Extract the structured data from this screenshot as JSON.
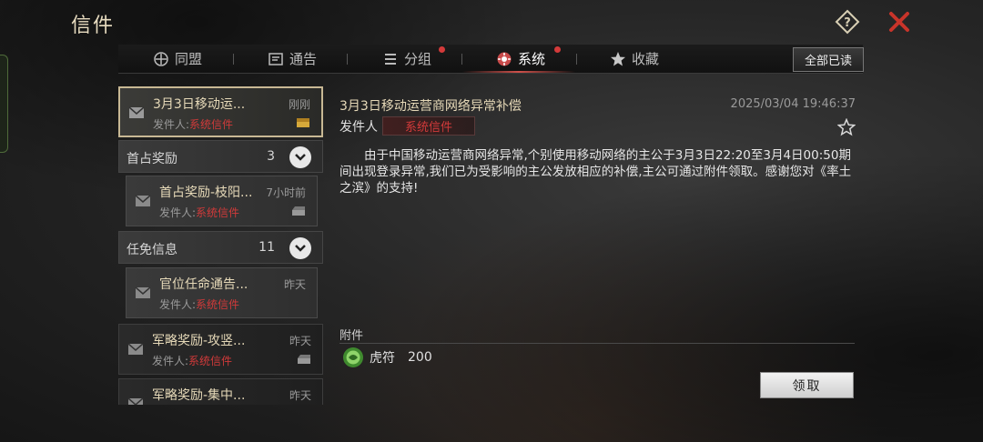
{
  "window": {
    "title": "信件"
  },
  "header": {
    "help_icon": "question-diamond-icon",
    "close_icon": "close-x-icon",
    "accent_color": "#c8342a"
  },
  "tabs": [
    {
      "label": "同盟",
      "icon": "alliance-emblem-icon",
      "has_dot": false,
      "active": false
    },
    {
      "label": "通告",
      "icon": "notice-board-icon",
      "has_dot": false,
      "active": false
    },
    {
      "label": "分组",
      "icon": "list-icon",
      "has_dot": true,
      "active": false
    },
    {
      "label": "系统",
      "icon": "system-gear-icon",
      "has_dot": true,
      "active": true
    },
    {
      "label": "收藏",
      "icon": "star-icon",
      "has_dot": false,
      "active": false
    }
  ],
  "toolbar": {
    "read_all_label": "全部已读"
  },
  "mail_list": {
    "items": [
      {
        "subject": "3月3日移动运...",
        "time": "刚刚",
        "sender_prefix": "发件人:",
        "sender": "系统信件",
        "selected": true
      },
      {
        "group_label": "首占奖励",
        "count": "3"
      },
      {
        "subject": "首占奖励-枝阳...",
        "time": "7小时前",
        "sender_prefix": "发件人:",
        "sender": "系统信件"
      },
      {
        "group_label": "任免信息",
        "count": "11"
      },
      {
        "subject": "官位任命通告...",
        "time": "昨天",
        "sender_prefix": "发件人:",
        "sender": "系统信件"
      },
      {
        "subject": "军略奖励-攻竖...",
        "time": "昨天",
        "sender_prefix": "发件人:",
        "sender": "系统信件"
      },
      {
        "subject": "军略奖励-集中...",
        "time": "昨天"
      }
    ]
  },
  "detail": {
    "subject": "3月3日移动运营商网络异常补偿",
    "time": "2025/03/04 19:46:37",
    "sender_label": "发件人",
    "sender": "系统信件",
    "body": "由于中国移动运营商网络异常,个别使用移动网络的主公于3月3日22:20至3月4日00:50期间出现登录异常,我们已为受影响的主公发放相应的补偿,主公可通过附件领取。感谢您对《率土之滨》的支持!",
    "attachment_label": "附件",
    "attachment": {
      "name": "虎符",
      "quantity": "200",
      "icon": "tiger-tally-gem-icon"
    },
    "claim_label": "领取"
  }
}
